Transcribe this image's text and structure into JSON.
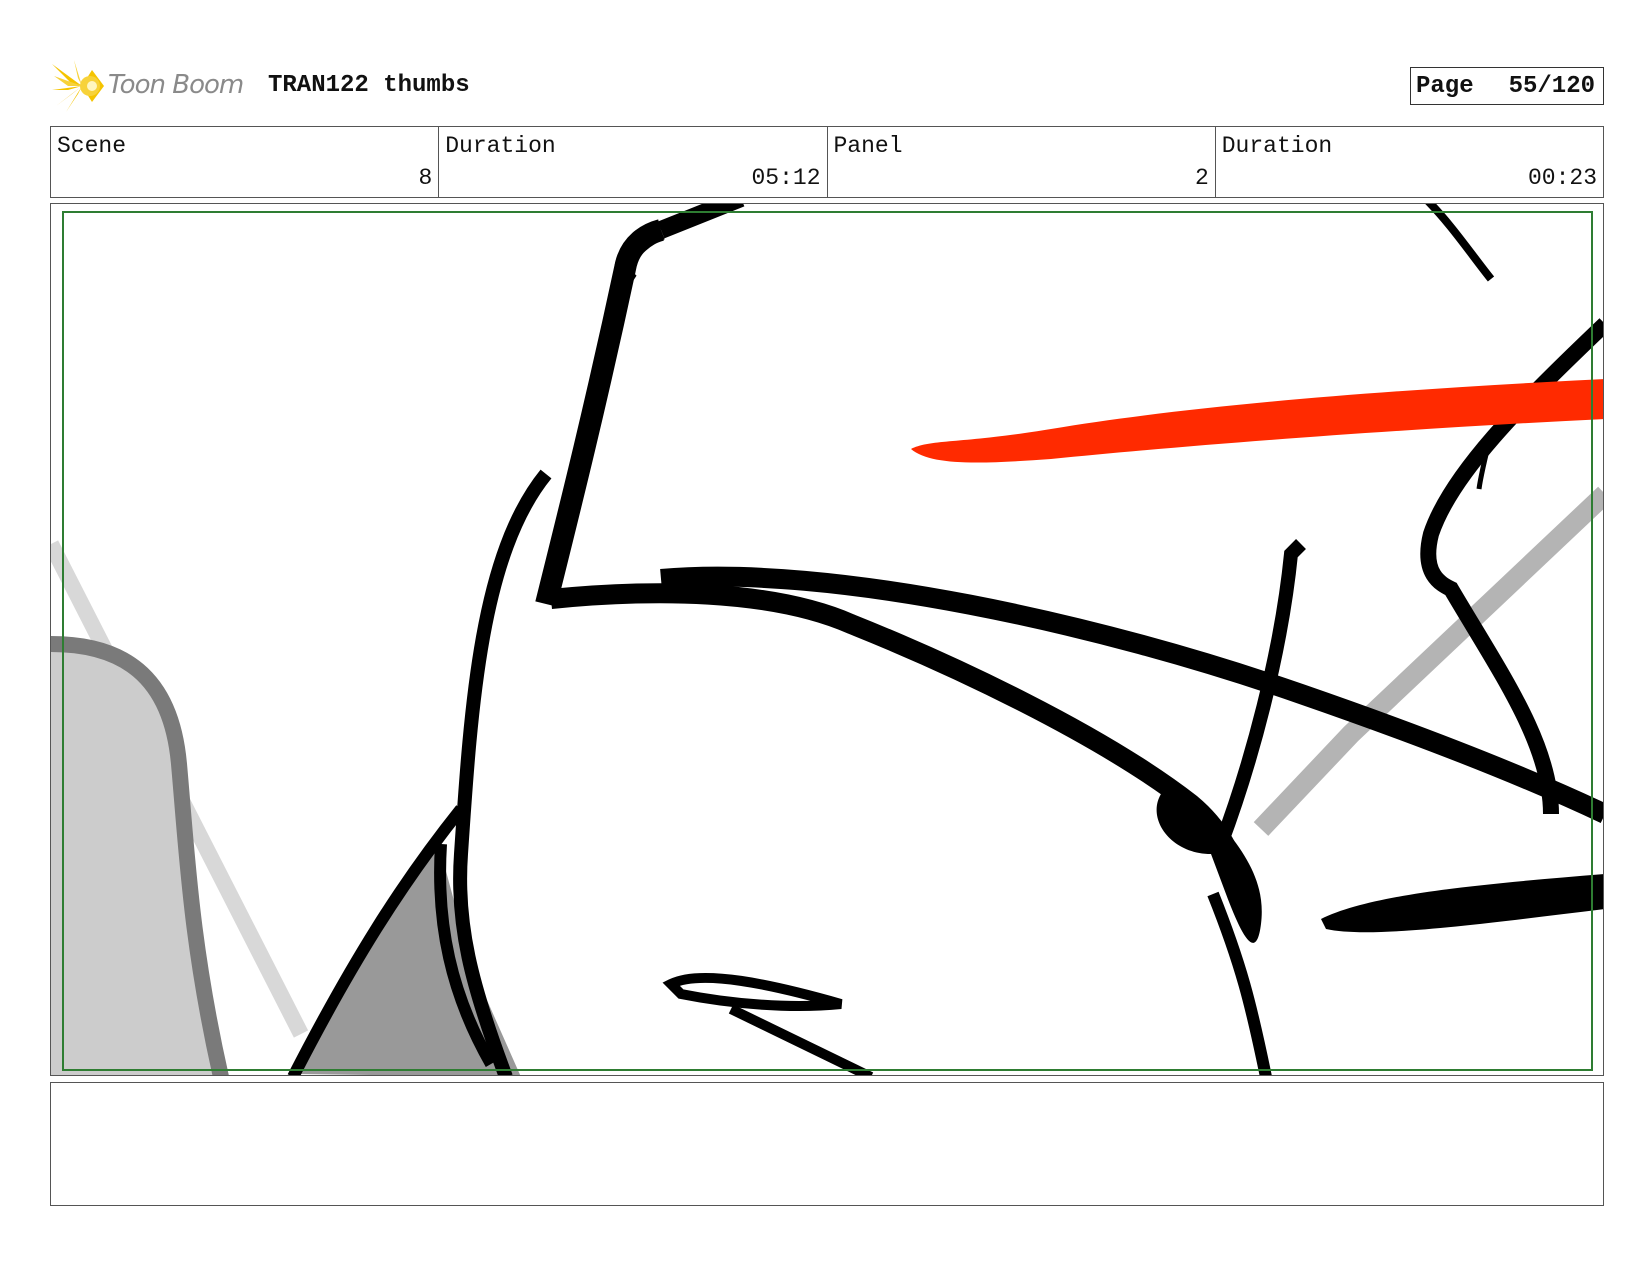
{
  "header": {
    "logo_text": "Toon Boom",
    "project_title": "TRAN122 thumbs",
    "page_label": "Page",
    "page_number": "55/120"
  },
  "info": {
    "scene_label": "Scene",
    "scene_value": "8",
    "scene_duration_label": "Duration",
    "scene_duration_value": "05:12",
    "panel_label": "Panel",
    "panel_value": "2",
    "panel_duration_label": "Duration",
    "panel_duration_value": "00:23"
  },
  "colors": {
    "safe_area": "#2e7d32",
    "red_stroke": "#ff2a00",
    "logo_yellow": "#f5c400"
  },
  "notes": {
    "text": ""
  }
}
